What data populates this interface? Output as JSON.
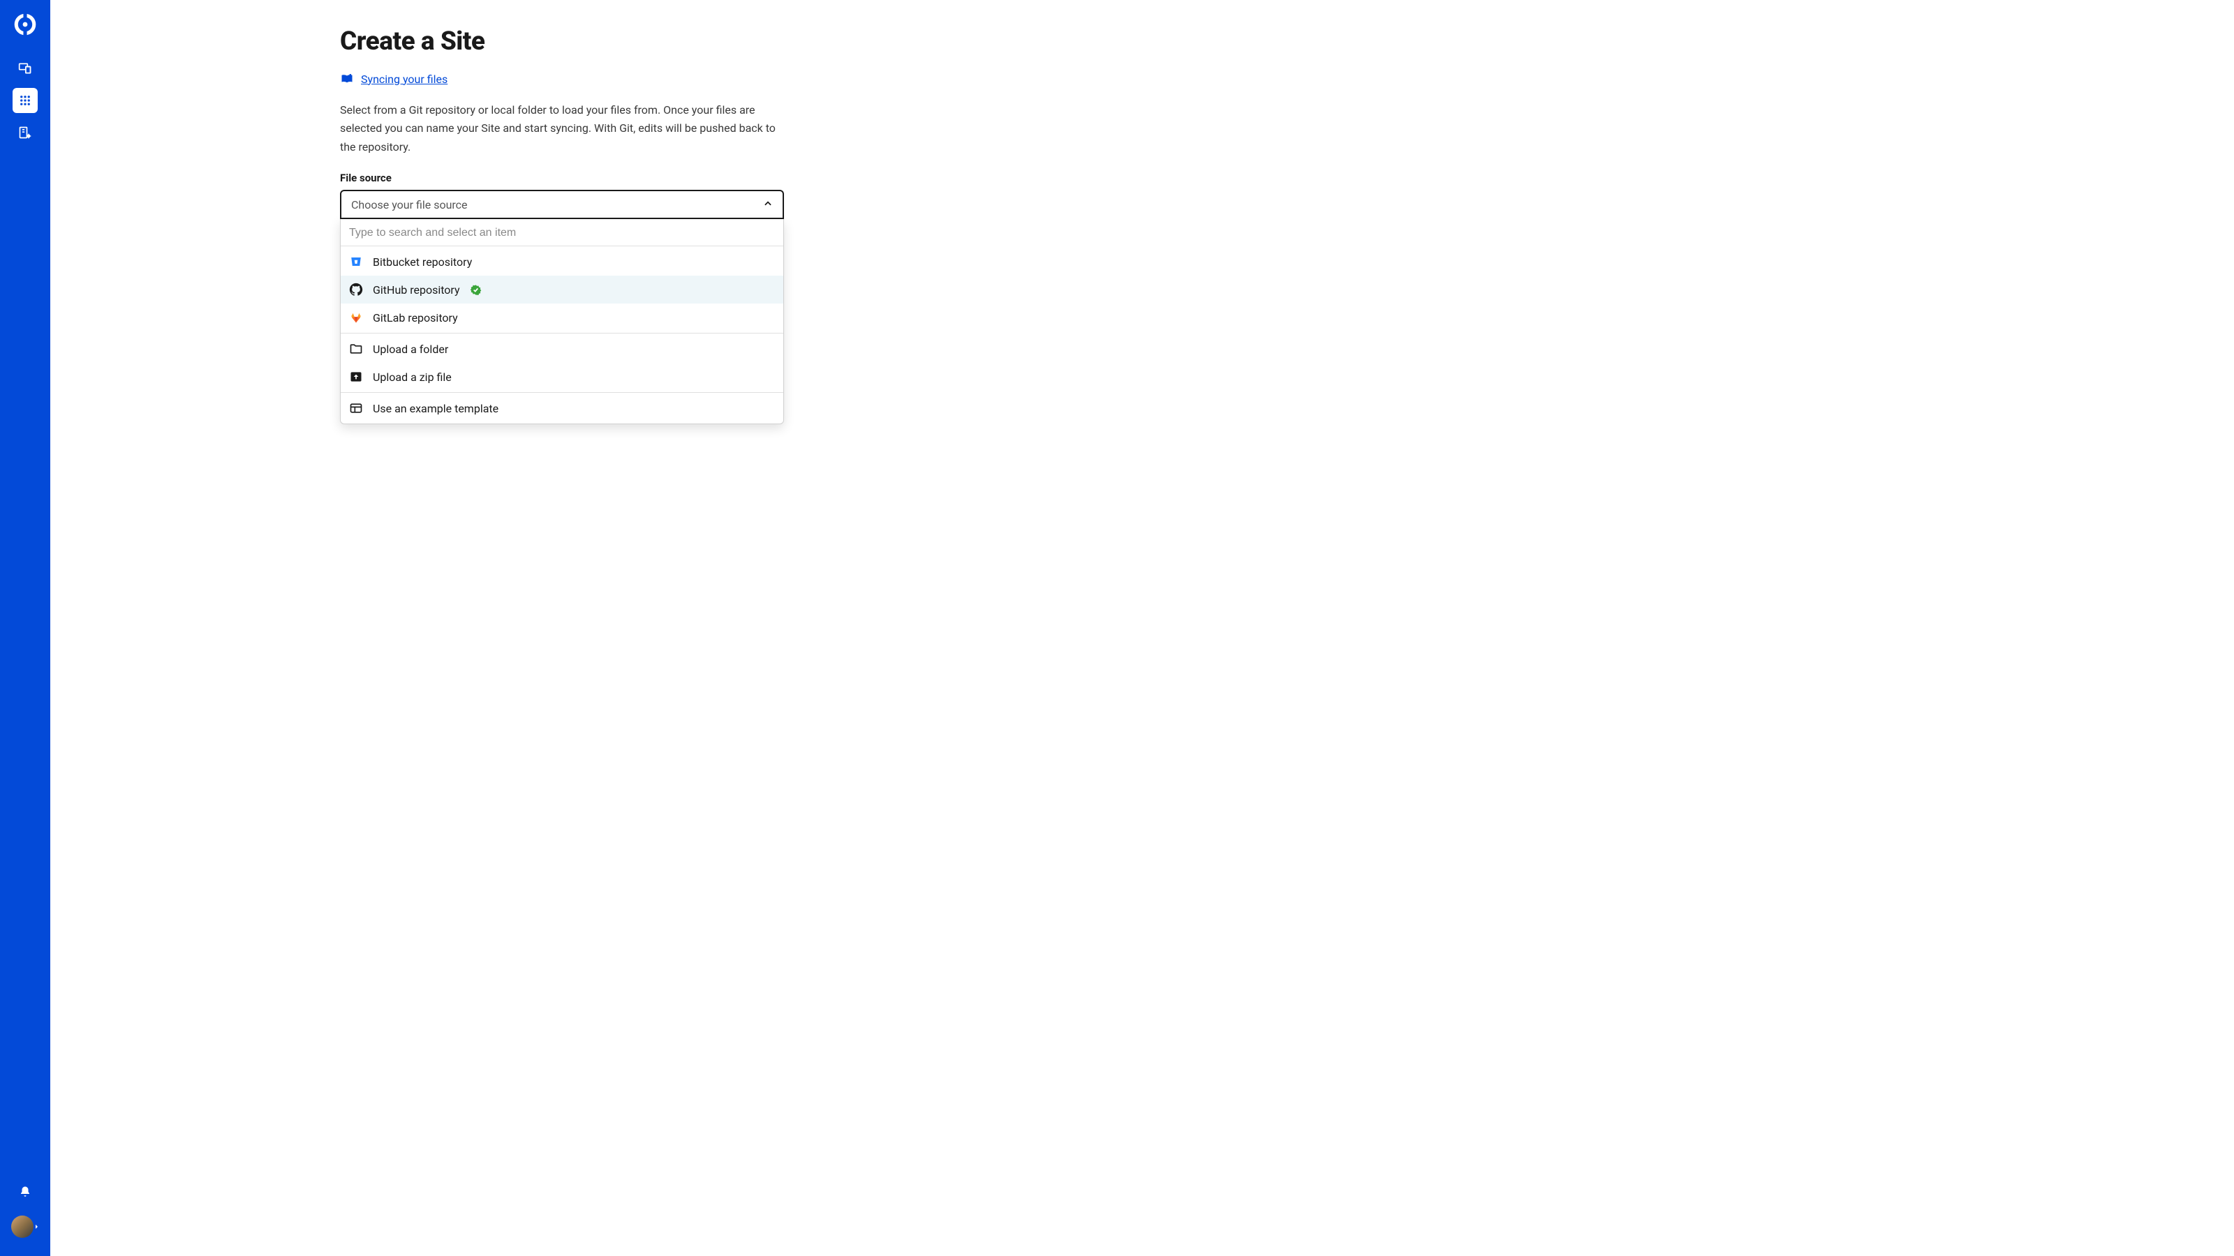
{
  "page": {
    "title": "Create a Site",
    "doc_link_label": "Syncing your files",
    "description": "Select from a Git repository or local folder to load your files from. Once your files are selected you can name your Site and start syncing. With Git, edits will be pushed back to the repository."
  },
  "form": {
    "file_source_label": "File source",
    "select_placeholder": "Choose your file source",
    "search_placeholder": "Type to search and select an item"
  },
  "options": {
    "bitbucket": "Bitbucket repository",
    "github": "GitHub repository",
    "gitlab": "GitLab repository",
    "upload_folder": "Upload a folder",
    "upload_zip": "Upload a zip file",
    "example_template": "Use an example template"
  },
  "sidebar": {
    "items": [
      "projects",
      "apps",
      "organization"
    ]
  }
}
